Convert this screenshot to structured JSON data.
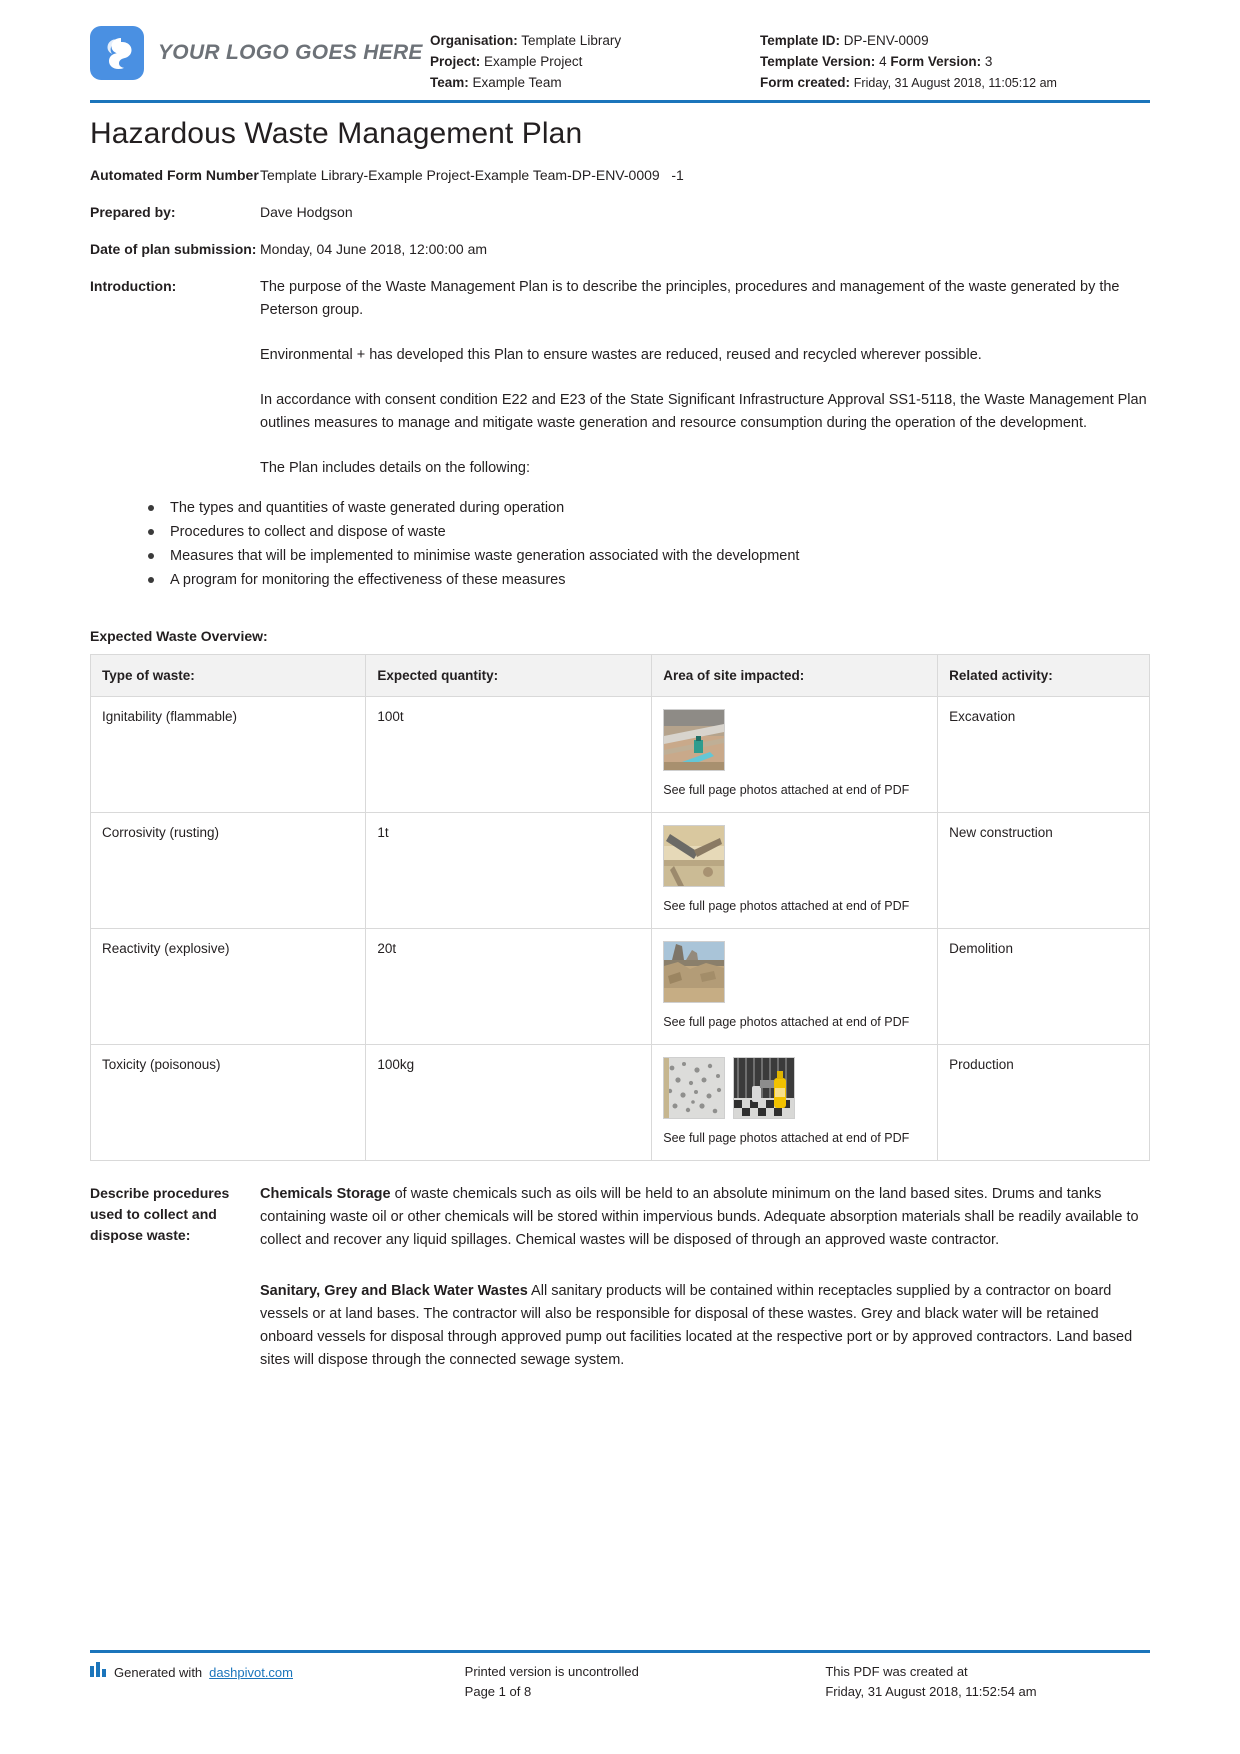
{
  "header": {
    "logo_text": "YOUR LOGO GOES HERE",
    "organisation_label": "Organisation:",
    "organisation_value": "Template Library",
    "project_label": "Project:",
    "project_value": "Example Project",
    "team_label": "Team:",
    "team_value": "Example Team",
    "template_id_label": "Template ID:",
    "template_id_value": "DP-ENV-0009",
    "template_version_label": "Template Version:",
    "template_version_value": "4",
    "form_version_label": "Form Version:",
    "form_version_value": "3",
    "form_created_label": "Form created:",
    "form_created_value": "Friday, 31 August 2018, 11:05:12 am",
    "accent_color": "#1b75bb",
    "logo_color": "#4a90e2"
  },
  "title": "Hazardous Waste Management Plan",
  "fields": {
    "automated_form_number_label": "Automated Form Number",
    "automated_form_number_value": "Template Library-Example Project-Example Team-DP-ENV-0009   -1",
    "prepared_by_label": "Prepared by:",
    "prepared_by_value": "Dave Hodgson",
    "date_of_plan_label": "Date of plan submission:",
    "date_of_plan_value": "Monday, 04 June 2018, 12:00:00 am",
    "introduction_label": "Introduction:"
  },
  "introduction": {
    "paragraphs": [
      "The purpose of the Waste Management Plan is to describe the principles, procedures and management of the waste generated by the Peterson group.",
      "Environmental + has developed this Plan to ensure wastes are reduced, reused and recycled wherever possible.",
      "In accordance with consent condition E22 and E23 of the State Significant Infrastructure Approval SS1-5118, the Waste Management Plan outlines measures to manage and mitigate waste generation and resource consumption during the operation of the development.",
      "The Plan includes details on the following:"
    ],
    "bullets": [
      "The types and quantities of waste generated during operation",
      "Procedures to collect and dispose of waste",
      "Measures that will be implemented to minimise waste generation associated with the development",
      "A program for monitoring the effectiveness of these measures"
    ]
  },
  "table": {
    "heading": "Expected Waste Overview:",
    "columns": [
      "Type of waste:",
      "Expected quantity:",
      "Area of site impacted:",
      "Related activity:"
    ],
    "photo_note": "See full page photos attached at end of PDF",
    "rows": [
      {
        "type": "Ignitability (flammable)",
        "quantity": "100t",
        "photos": [
          "excavation-site-photo"
        ],
        "activity": "Excavation"
      },
      {
        "type": "Corrosivity (rusting)",
        "quantity": "1t",
        "photos": [
          "rusted-steel-beam-photo"
        ],
        "activity": "New construction"
      },
      {
        "type": "Reactivity (explosive)",
        "quantity": "20t",
        "photos": [
          "demolition-rubble-photo"
        ],
        "activity": "Demolition"
      },
      {
        "type": "Toxicity (poisonous)",
        "quantity": "100kg",
        "photos": [
          "gravel-pile-photo",
          "chemical-bottle-photo"
        ],
        "activity": "Production"
      }
    ]
  },
  "procedures": {
    "label": "Describe procedures used to collect and dispose waste:",
    "paragraphs": [
      {
        "lead": "Chemicals Storage",
        "text": " of waste chemicals such as oils will be held to an absolute minimum on the land based sites. Drums and tanks containing waste oil or other chemicals will be stored within impervious bunds. Adequate absorption materials shall be readily available to collect and recover any liquid spillages. Chemical wastes will be disposed of through an approved waste contractor."
      },
      {
        "lead": "Sanitary, Grey and Black Water Wastes",
        "text": " All sanitary products will be contained within receptacles supplied by a contractor on board vessels or at land bases. The contractor will also be responsible for disposal of these wastes. Grey and black water will be retained onboard vessels for disposal through approved pump out facilities located at the respective port or by approved contractors. Land based sites will dispose through the connected sewage system."
      }
    ]
  },
  "footer": {
    "generated_prefix": "Generated with ",
    "generated_link": "dashpivot.com",
    "uncontrolled": "Printed version is uncontrolled",
    "page_number": "Page 1 of 8",
    "created_line1": "This PDF was created at",
    "created_line2": "Friday, 31 August 2018, 11:52:54 am"
  }
}
